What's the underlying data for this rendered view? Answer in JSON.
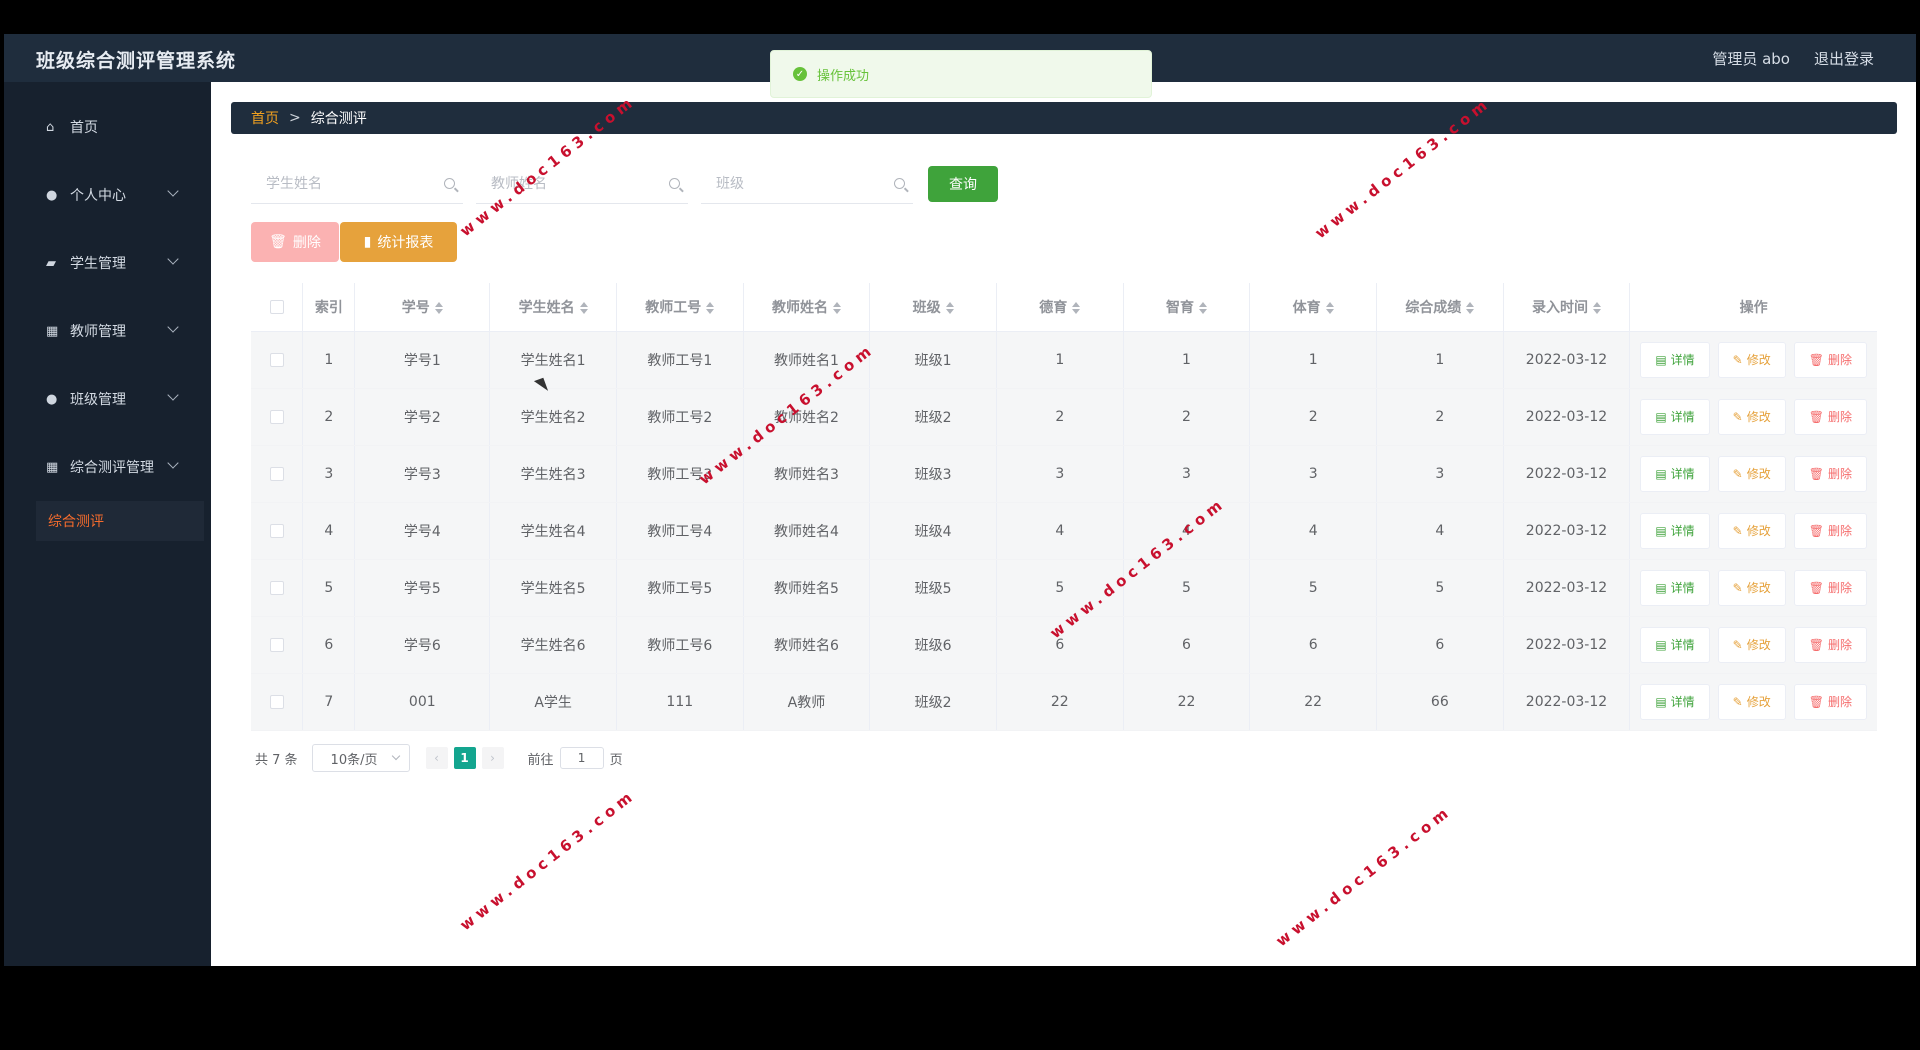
{
  "app": {
    "title": "班级综合测评管理系统"
  },
  "header": {
    "user_label": "管理员 abo",
    "logout_label": "退出登录"
  },
  "toast": {
    "message": "操作成功"
  },
  "sidebar": {
    "items": [
      {
        "label": "首页",
        "icon": "home-icon"
      },
      {
        "label": "个人中心",
        "icon": "user-icon"
      },
      {
        "label": "学生管理",
        "icon": "chat-icon"
      },
      {
        "label": "教师管理",
        "icon": "grid-icon"
      },
      {
        "label": "班级管理",
        "icon": "user-icon"
      },
      {
        "label": "综合测评管理",
        "icon": "grid-icon"
      }
    ],
    "active_sub": "综合测评"
  },
  "breadcrumb": {
    "home": "首页",
    "separator": ">",
    "current": "综合测评"
  },
  "search": {
    "student_name_placeholder": "学生姓名",
    "teacher_name_placeholder": "教师姓名",
    "class_placeholder": "班级",
    "query_label": "查询"
  },
  "actions": {
    "delete_label": "删除",
    "report_label": "统计报表"
  },
  "table": {
    "headers": [
      "索引",
      "学号",
      "学生姓名",
      "教师工号",
      "教师姓名",
      "班级",
      "德育",
      "智育",
      "体育",
      "综合成绩",
      "录入时间",
      "操作"
    ],
    "rows": [
      [
        "1",
        "学号1",
        "学生姓名1",
        "教师工号1",
        "教师姓名1",
        "班级1",
        "1",
        "1",
        "1",
        "1",
        "2022-03-12"
      ],
      [
        "2",
        "学号2",
        "学生姓名2",
        "教师工号2",
        "教师姓名2",
        "班级2",
        "2",
        "2",
        "2",
        "2",
        "2022-03-12"
      ],
      [
        "3",
        "学号3",
        "学生姓名3",
        "教师工号3",
        "教师姓名3",
        "班级3",
        "3",
        "3",
        "3",
        "3",
        "2022-03-12"
      ],
      [
        "4",
        "学号4",
        "学生姓名4",
        "教师工号4",
        "教师姓名4",
        "班级4",
        "4",
        "4",
        "4",
        "4",
        "2022-03-12"
      ],
      [
        "5",
        "学号5",
        "学生姓名5",
        "教师工号5",
        "教师姓名5",
        "班级5",
        "5",
        "5",
        "5",
        "5",
        "2022-03-12"
      ],
      [
        "6",
        "学号6",
        "学生姓名6",
        "教师工号6",
        "教师姓名6",
        "班级6",
        "6",
        "6",
        "6",
        "6",
        "2022-03-12"
      ],
      [
        "7",
        "001",
        "A学生",
        "111",
        "A教师",
        "班级2",
        "22",
        "22",
        "22",
        "66",
        "2022-03-12"
      ]
    ],
    "op_detail": "详情",
    "op_edit": "修改",
    "op_delete": "删除"
  },
  "pagination": {
    "total": "共 7 条",
    "page_size": "10条/页",
    "current_page": "1",
    "goto_label": "前往",
    "goto_value": "1",
    "page_suffix": "页"
  },
  "watermark": {
    "text": "www.doc163.com"
  },
  "colors": {
    "accent_green": "#3fa33b",
    "accent_orange": "#e6a23c",
    "danger": "#f56c6c",
    "sidebar_bg": "#17212e",
    "header_bg": "#1f2d3d"
  }
}
